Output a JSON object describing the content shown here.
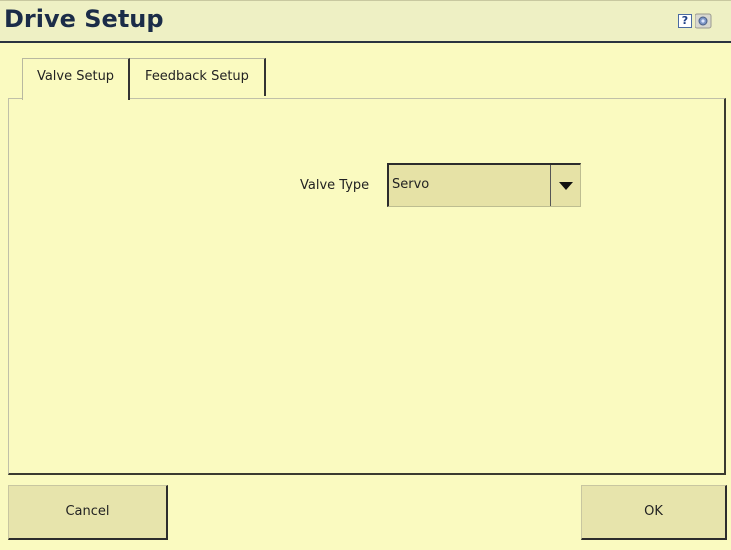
{
  "window": {
    "title": "Drive Setup",
    "help_icon": "?"
  },
  "icons": {
    "help": "help-icon",
    "camera": "camera-icon"
  },
  "tabs": [
    {
      "label": "Valve Setup",
      "active": true
    },
    {
      "label": "Feedback Setup",
      "active": false
    }
  ],
  "valve_setup": {
    "valve_type_label": "Valve Type",
    "valve_type_value": "Servo"
  },
  "buttons": {
    "cancel": "Cancel",
    "ok": "OK"
  },
  "colors": {
    "background": "#fafac0",
    "title_text": "#1b2c48",
    "button_bg": "#e7e4ac"
  }
}
